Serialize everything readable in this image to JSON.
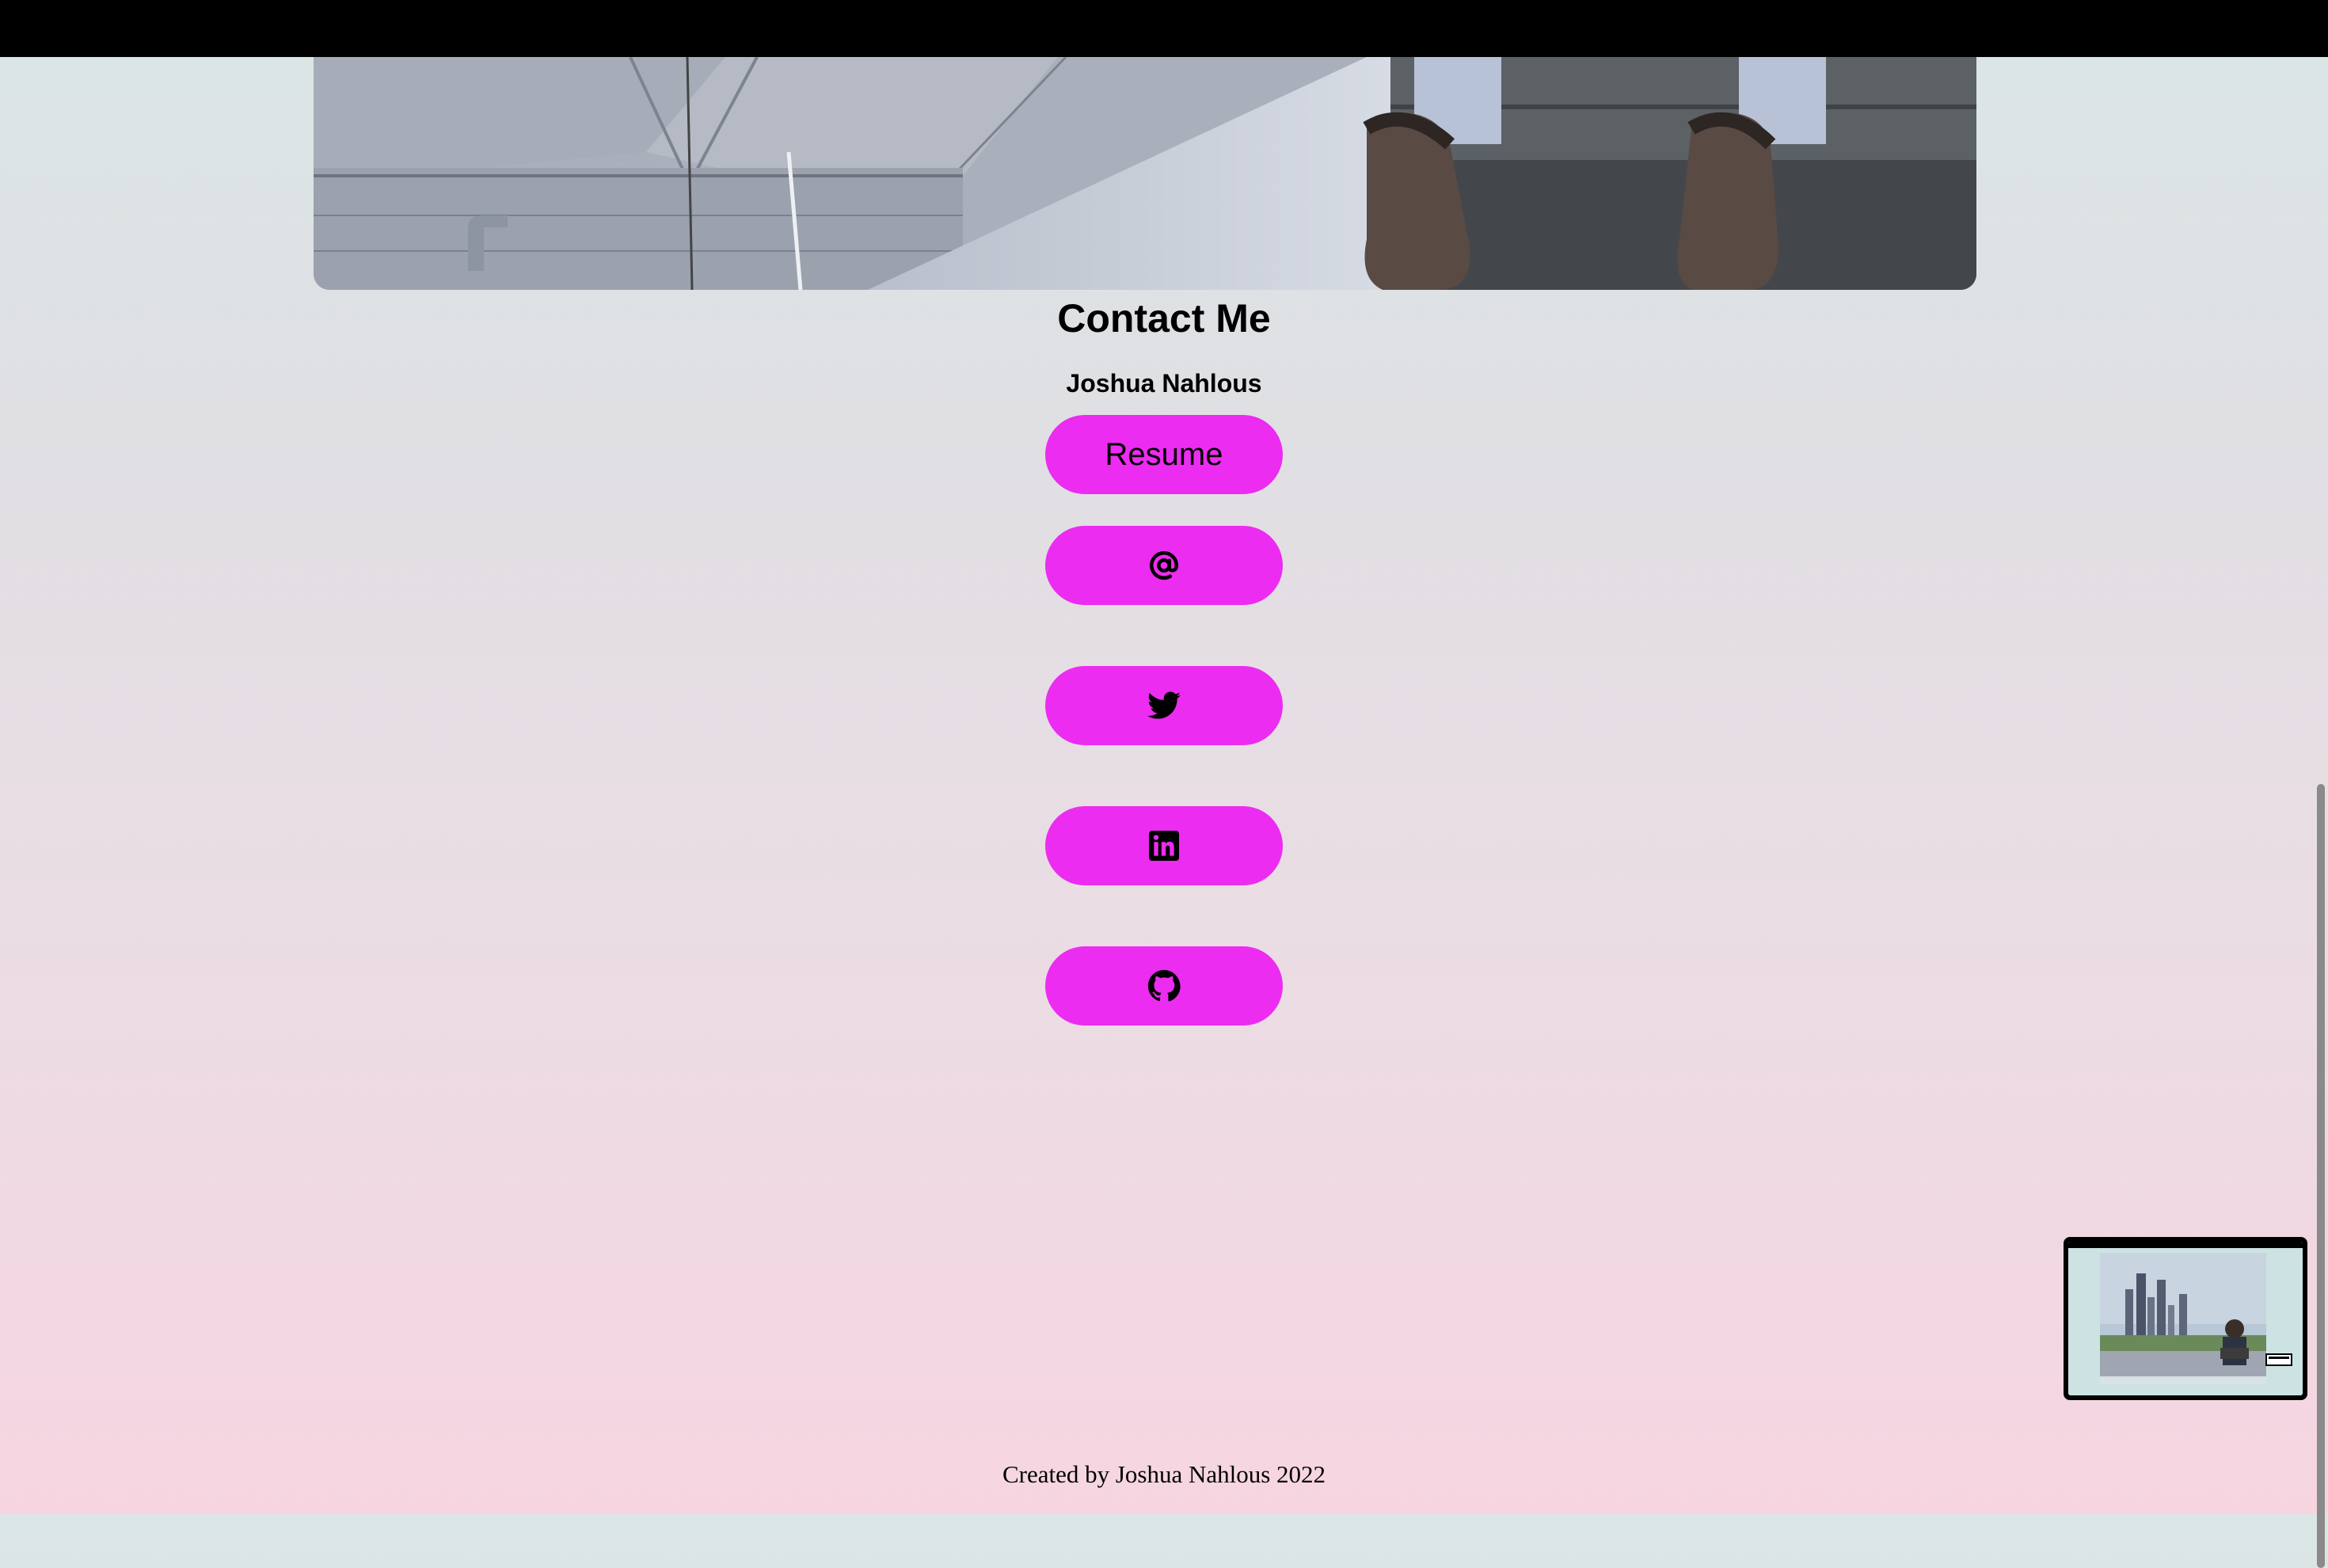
{
  "page": {
    "title": "Contact Me",
    "name": "Joshua Nahlous"
  },
  "buttons": {
    "resume_label": "Resume",
    "email_icon": "at-icon",
    "twitter_icon": "twitter-icon",
    "linkedin_icon": "linkedin-icon",
    "github_icon": "github-icon"
  },
  "footer": {
    "text": "Created by Joshua Nahlous 2022"
  },
  "colors": {
    "button": "#ec2cf0",
    "top_bar": "#000000",
    "gradient_top": "#dbe6e6",
    "gradient_bottom": "#f6d5e1"
  }
}
